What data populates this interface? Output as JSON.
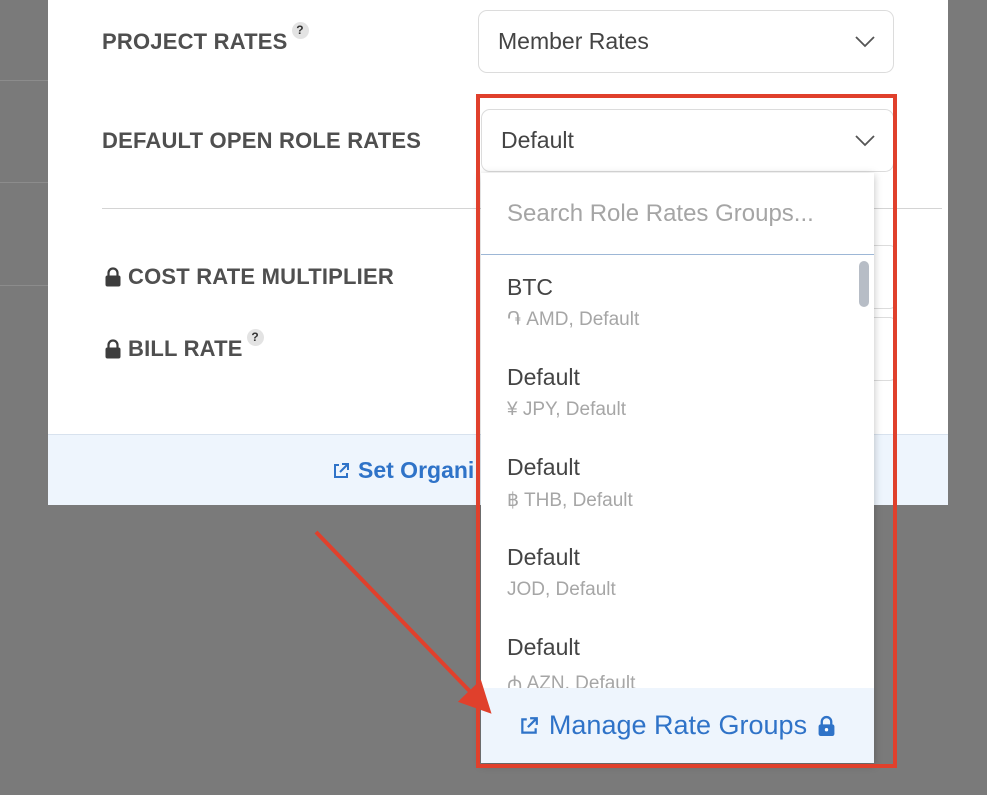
{
  "form": {
    "project_rates_label": "PROJECT RATES",
    "project_rates_help": "?",
    "project_rates_value": "Member Rates",
    "default_open_role_rates_label": "DEFAULT OPEN ROLE RATES",
    "default_open_role_rates_value": "Default",
    "cost_rate_multiplier_label": "COST RATE MULTIPLIER",
    "bill_rate_label": "BILL RATE",
    "bill_rate_help": "?"
  },
  "footer": {
    "link_label": "Set Organi"
  },
  "dropdown": {
    "search_placeholder": "Search Role Rates Groups...",
    "options": [
      {
        "name": "BTC",
        "sub": "֏ AMD, Default"
      },
      {
        "name": "Default",
        "sub": "¥ JPY, Default"
      },
      {
        "name": "Default",
        "sub": "฿ THB, Default"
      },
      {
        "name": "Default",
        "sub": "JOD, Default"
      },
      {
        "name": "Default",
        "sub": "₼ AZN, Default"
      }
    ],
    "manage_label": "Manage Rate Groups"
  },
  "colors": {
    "accent": "#2f73c8",
    "highlight": "#e0402c",
    "overlay": "#7a7a7a"
  }
}
